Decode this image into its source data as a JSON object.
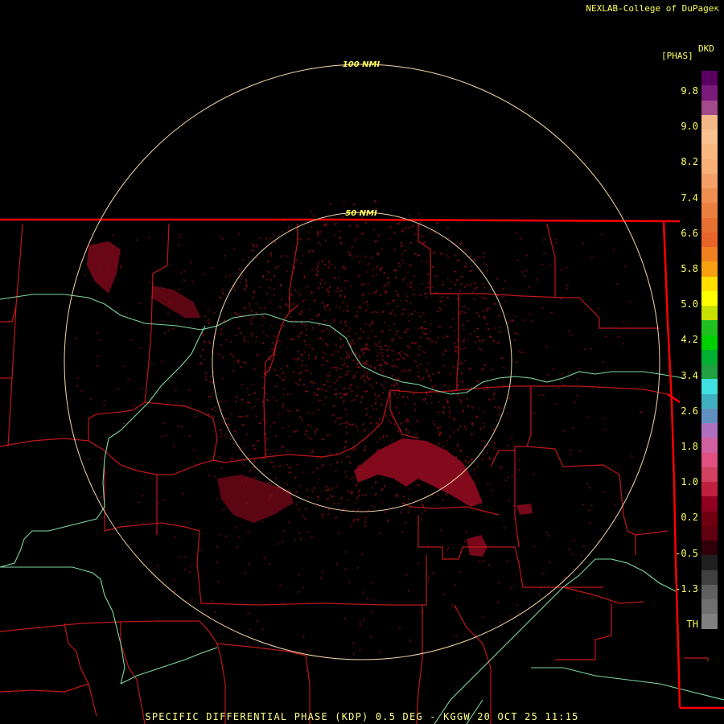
{
  "credit": "NEXLAB-College of DuPage",
  "credit_icon": "cursor-icon",
  "legend": {
    "title": "DKD",
    "unit": "[PHAS]",
    "ticks": [
      "9.8",
      "9.0",
      "8.2",
      "7.4",
      "6.6",
      "5.8",
      "5.0",
      "4.2",
      "3.4",
      "2.6",
      "1.8",
      "1.0",
      "0.2",
      "-0.5",
      "-1.3",
      "TH"
    ],
    "colors": [
      "#5a0060",
      "#7a1a7a",
      "#a24a8a",
      "#f4b888",
      "#fac090",
      "#f8b880",
      "#f8b078",
      "#f4a068",
      "#f09050",
      "#ec8040",
      "#e87030",
      "#e86428",
      "#f08020",
      "#f8a010",
      "#ffe000",
      "#ffff00",
      "#c8e000",
      "#20c020",
      "#00d000",
      "#00b030",
      "#20a040",
      "#40e0e0",
      "#40b0c0",
      "#6090c0",
      "#b070c0",
      "#d060a0",
      "#e05080",
      "#d04060",
      "#c02040",
      "#900020",
      "#700010",
      "#600010",
      "#300008",
      "#202020",
      "#404040",
      "#606060",
      "#707070",
      "#808080",
      "#000000"
    ]
  },
  "rings": [
    {
      "label": "100 NMI"
    },
    {
      "label": "50 NMI"
    }
  ],
  "footer": "SPECIFIC DIFFERENTIAL PHASE (KDP) 0.5 DEG - KGGW 20 OCT 25 11:15"
}
